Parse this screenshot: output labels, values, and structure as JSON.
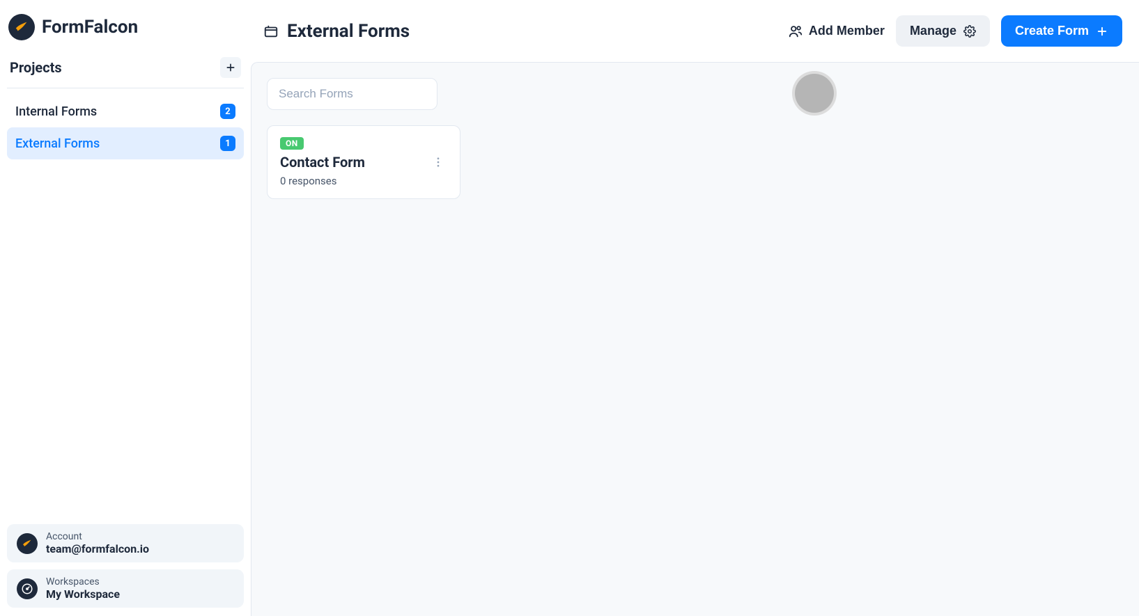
{
  "brand": {
    "name": "FormFalcon"
  },
  "sidebar": {
    "section_title": "Projects",
    "projects": [
      {
        "name": "Internal Forms",
        "count": "2",
        "active": false
      },
      {
        "name": "External Forms",
        "count": "1",
        "active": true
      }
    ],
    "account": {
      "label": "Account",
      "value": "team@formfalcon.io"
    },
    "workspace": {
      "label": "Workspaces",
      "value": "My Workspace"
    }
  },
  "header": {
    "title": "External Forms",
    "add_member": "Add Member",
    "manage": "Manage",
    "create_form": "Create Form"
  },
  "search": {
    "placeholder": "Search Forms"
  },
  "forms": [
    {
      "status": "ON",
      "title": "Contact Form",
      "responses": "0 responses"
    }
  ]
}
